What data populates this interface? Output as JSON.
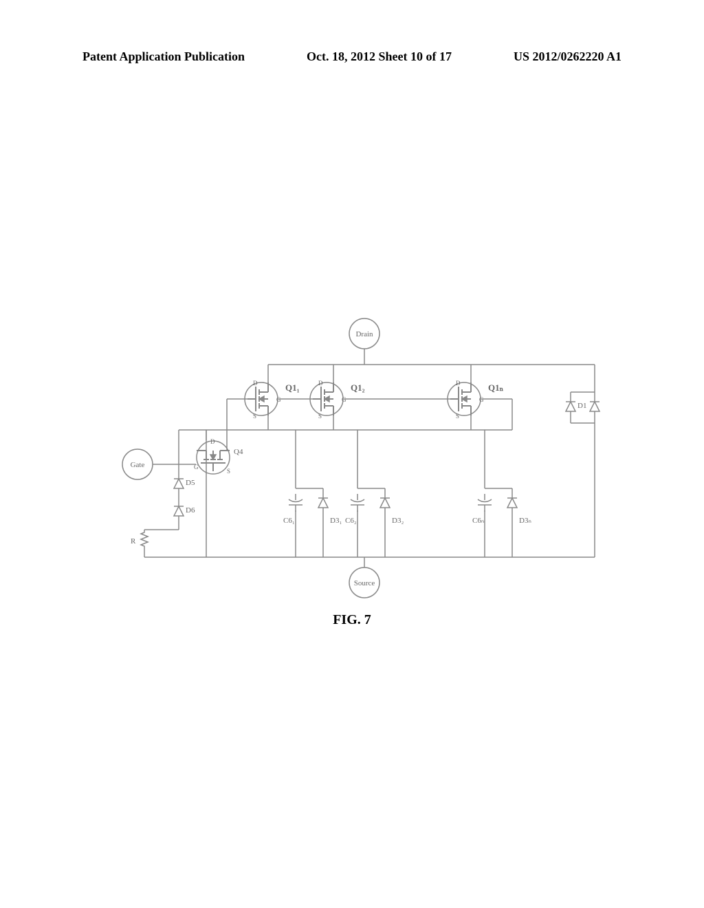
{
  "header": {
    "left": "Patent Application Publication",
    "center": "Oct. 18, 2012  Sheet 10 of 17",
    "right": "US 2012/0262220 A1"
  },
  "figure": {
    "caption": "FIG. 7",
    "terminals": {
      "drain": "Drain",
      "gate": "Gate",
      "source": "Source"
    },
    "transistors": {
      "q11": "Q1₁",
      "q12": "Q1₂",
      "q1n": "Q1ₙ",
      "q4": "Q4"
    },
    "pins": {
      "d": "D",
      "g": "G",
      "s": "S"
    },
    "diodes": {
      "d1": "D1",
      "d5": "D5",
      "d6": "D6",
      "d31": "D3₁",
      "d32": "D3₂",
      "d3n": "D3ₙ"
    },
    "caps": {
      "c61": "C6₁",
      "c62": "C6₂",
      "c6n": "C6ₙ"
    },
    "resistor": "R"
  }
}
